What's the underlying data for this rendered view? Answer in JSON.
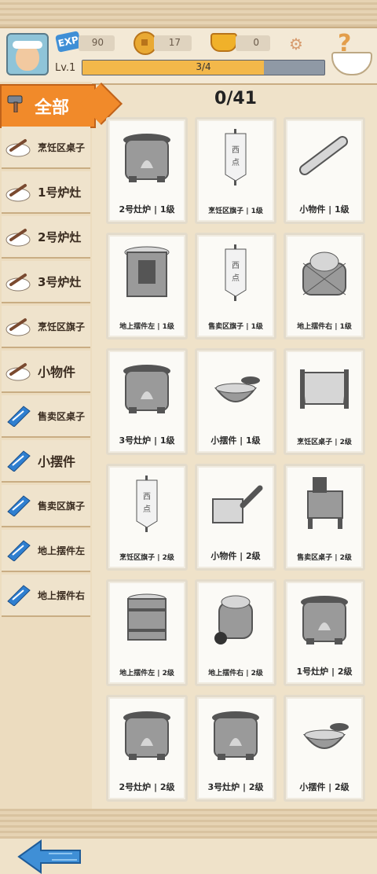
{
  "header": {
    "exp_icon": "EXP",
    "exp_value": "90",
    "coin_value": "17",
    "ingot_value": "0",
    "level": "Lv.1",
    "progress_text": "3/4",
    "progress_fraction": 0.75
  },
  "sidebar": {
    "all_label": "全部",
    "items": [
      {
        "label": "烹饪区桌子",
        "icon": "dumpling-icon"
      },
      {
        "label": "1号炉灶",
        "icon": "dumpling-icon"
      },
      {
        "label": "2号炉灶",
        "icon": "dumpling-icon"
      },
      {
        "label": "3号炉灶",
        "icon": "dumpling-icon"
      },
      {
        "label": "烹饪区旗子",
        "icon": "dumpling-icon"
      },
      {
        "label": "小物件",
        "icon": "dumpling-icon"
      },
      {
        "label": "售卖区桌子",
        "icon": "scroll-icon"
      },
      {
        "label": "小摆件",
        "icon": "scroll-icon"
      },
      {
        "label": "售卖区旗子",
        "icon": "scroll-icon"
      },
      {
        "label": "地上摆件左",
        "icon": "scroll-icon"
      },
      {
        "label": "地上摆件右",
        "icon": "scroll-icon"
      }
    ]
  },
  "main": {
    "count": "0/41",
    "cards": [
      {
        "label": "2号灶炉 | 1级",
        "icon": "stove-icon"
      },
      {
        "label": "烹饪区旗子 | 1级",
        "icon": "banner-icon"
      },
      {
        "label": "小物件 | 1级",
        "icon": "rolling-pin-icon"
      },
      {
        "label": "地上摆件左 | 1级",
        "icon": "cabinet-icon"
      },
      {
        "label": "售卖区旗子 | 1级",
        "icon": "banner-icon"
      },
      {
        "label": "地上摆件右 | 1级",
        "icon": "basket-icon"
      },
      {
        "label": "3号灶炉 | 1级",
        "icon": "stove-icon"
      },
      {
        "label": "小摆件 | 1级",
        "icon": "bowl-icon"
      },
      {
        "label": "烹饪区桌子 | 2级",
        "icon": "table-icon"
      },
      {
        "label": "烹饪区旗子 | 2级",
        "icon": "banner-icon"
      },
      {
        "label": "小物件 | 2级",
        "icon": "cleaver-icon"
      },
      {
        "label": "售卖区桌子 | 2级",
        "icon": "stall-icon"
      },
      {
        "label": "地上摆件左 | 2级",
        "icon": "barrel-icon"
      },
      {
        "label": "地上摆件右 | 2级",
        "icon": "jar-icon"
      },
      {
        "label": "1号灶炉 | 2级",
        "icon": "stove-icon"
      },
      {
        "label": "2号灶炉 | 2级",
        "icon": "stove-icon"
      },
      {
        "label": "3号灶炉 | 2级",
        "icon": "stove-icon"
      },
      {
        "label": "小摆件 | 2级",
        "icon": "bowl-icon"
      }
    ]
  },
  "colors": {
    "accent": "#f18a2a",
    "progress": "#f3b84a",
    "back_arrow": "#3f8fd6"
  }
}
